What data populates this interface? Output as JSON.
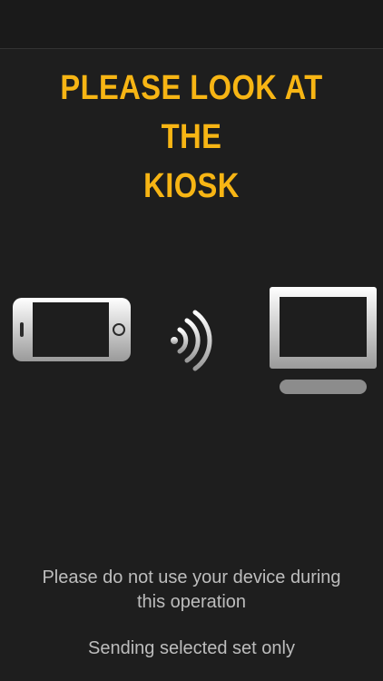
{
  "header": {
    "line1": "PLEASE LOOK AT THE",
    "line2": "KIOSK"
  },
  "icons": {
    "phone": "smartphone-landscape-icon",
    "signal": "wireless-signal-icon",
    "kiosk": "monitor-icon"
  },
  "notice": {
    "line1": "Please do not use your device during",
    "line2": "this operation"
  },
  "status": "Sending selected set only",
  "colors": {
    "background": "#1e1e1e",
    "accent": "#f7b514",
    "text": "#bdbdbd"
  }
}
